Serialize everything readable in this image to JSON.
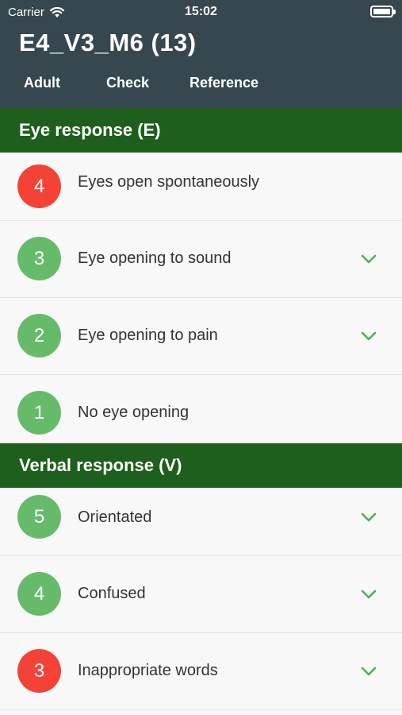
{
  "status_bar": {
    "carrier": "Carrier",
    "time": "15:02"
  },
  "header": {
    "title": "E4_V3_M6 (13)"
  },
  "tabs": [
    {
      "label": "Adult"
    },
    {
      "label": "Check"
    },
    {
      "label": "Reference"
    }
  ],
  "sections": [
    {
      "title": "Eye response (E)",
      "items": [
        {
          "score": "4",
          "label": "Eyes open spontaneously",
          "badge_color": "#f44336",
          "checked": false
        },
        {
          "score": "3",
          "label": "Eye opening to sound",
          "badge_color": "#66bb6a",
          "checked": true
        },
        {
          "score": "2",
          "label": "Eye opening to pain",
          "badge_color": "#66bb6a",
          "checked": true
        },
        {
          "score": "1",
          "label": "No eye opening",
          "badge_color": "#66bb6a",
          "checked": false
        }
      ]
    },
    {
      "title": "Verbal response (V)",
      "items": [
        {
          "score": "5",
          "label": "Orientated",
          "badge_color": "#66bb6a",
          "checked": true
        },
        {
          "score": "4",
          "label": "Confused",
          "badge_color": "#66bb6a",
          "checked": true
        },
        {
          "score": "3",
          "label": "Inappropriate words",
          "badge_color": "#f44336",
          "checked": true
        }
      ]
    }
  ],
  "colors": {
    "header_bg": "#37474f",
    "section_bg": "#1f5f1d",
    "check": "#4caf50"
  },
  "icons": {
    "wifi": "wifi-icon",
    "battery": "battery-icon",
    "check": "checkmark-icon"
  }
}
